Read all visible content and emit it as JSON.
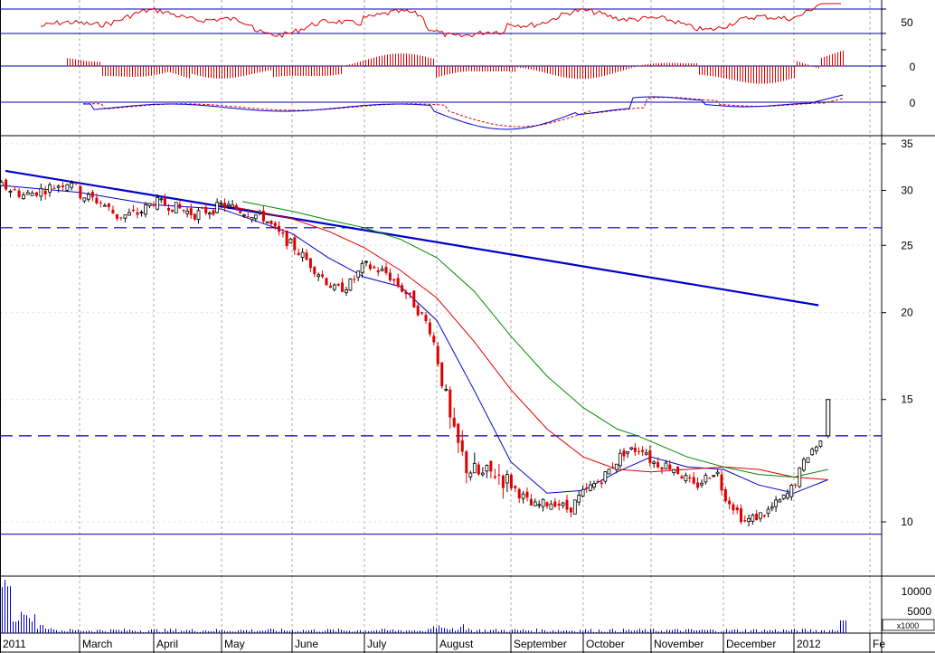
{
  "chart_data": {
    "type": "candlestick",
    "months": [
      "2011",
      "March",
      "April",
      "May",
      "June",
      "July",
      "August",
      "September",
      "October",
      "November",
      "December",
      "2012",
      "Fe"
    ],
    "price_axis": {
      "scale": "log",
      "ticks": [
        "35",
        "30",
        "25",
        "20",
        "15",
        "10"
      ],
      "ylim": [
        9,
        37
      ]
    },
    "volume_axis": {
      "ticks": [
        "10000",
        "5000"
      ],
      "unit": "x1000"
    },
    "indicator_ticks": {
      "rsi": [
        "50"
      ],
      "histogram": [
        "0"
      ],
      "macd": [
        "0"
      ]
    },
    "reference_levels": {
      "rsi_upper": 70,
      "rsi_lower": 30,
      "support_dashed_upper": 26.5,
      "support_dashed_lower": 13.3,
      "support_solid": 9.6
    },
    "trendline": {
      "start": {
        "x": 0.0,
        "y": 32.0
      },
      "end": {
        "x": 11.3,
        "y": 20.5
      }
    },
    "price_series": [
      {
        "x": 0.0,
        "y": 30.5
      },
      {
        "x": 0.3,
        "y": 29.5
      },
      {
        "x": 0.6,
        "y": 30.2
      },
      {
        "x": 0.9,
        "y": 31.0
      },
      {
        "x": 1.0,
        "y": 29.6
      },
      {
        "x": 1.3,
        "y": 28.8
      },
      {
        "x": 1.5,
        "y": 27.5
      },
      {
        "x": 1.8,
        "y": 27.8
      },
      {
        "x": 2.0,
        "y": 28.9
      },
      {
        "x": 2.3,
        "y": 28.4
      },
      {
        "x": 2.6,
        "y": 27.7
      },
      {
        "x": 2.9,
        "y": 28.2
      },
      {
        "x": 3.0,
        "y": 28.6
      },
      {
        "x": 3.3,
        "y": 28.0
      },
      {
        "x": 3.6,
        "y": 27.4
      },
      {
        "x": 3.8,
        "y": 26.0
      },
      {
        "x": 4.0,
        "y": 25.0
      },
      {
        "x": 4.3,
        "y": 23.2
      },
      {
        "x": 4.6,
        "y": 21.5
      },
      {
        "x": 4.8,
        "y": 22.0
      },
      {
        "x": 5.0,
        "y": 23.4
      },
      {
        "x": 5.3,
        "y": 22.8
      },
      {
        "x": 5.6,
        "y": 21.2
      },
      {
        "x": 5.9,
        "y": 19.0
      },
      {
        "x": 6.0,
        "y": 17.5
      },
      {
        "x": 6.2,
        "y": 13.5
      },
      {
        "x": 6.4,
        "y": 12.0
      },
      {
        "x": 6.6,
        "y": 11.6
      },
      {
        "x": 6.8,
        "y": 11.8
      },
      {
        "x": 7.0,
        "y": 11.3
      },
      {
        "x": 7.3,
        "y": 10.5
      },
      {
        "x": 7.6,
        "y": 10.7
      },
      {
        "x": 7.8,
        "y": 10.4
      },
      {
        "x": 8.0,
        "y": 11.0
      },
      {
        "x": 8.3,
        "y": 11.6
      },
      {
        "x": 8.6,
        "y": 12.6
      },
      {
        "x": 8.9,
        "y": 12.8
      },
      {
        "x": 9.0,
        "y": 12.2
      },
      {
        "x": 9.3,
        "y": 12.0
      },
      {
        "x": 9.6,
        "y": 11.2
      },
      {
        "x": 9.9,
        "y": 11.9
      },
      {
        "x": 10.0,
        "y": 11.0
      },
      {
        "x": 10.3,
        "y": 10.0
      },
      {
        "x": 10.6,
        "y": 10.3
      },
      {
        "x": 10.9,
        "y": 10.9
      },
      {
        "x": 11.0,
        "y": 11.3
      },
      {
        "x": 11.2,
        "y": 12.6
      },
      {
        "x": 11.35,
        "y": 13.0
      },
      {
        "x": 11.45,
        "y": 15.0
      }
    ],
    "ma_series": [
      {
        "color": "#0000cc",
        "points": [
          {
            "x": 0.0,
            "y": 30.5
          },
          {
            "x": 1.0,
            "y": 29.8
          },
          {
            "x": 2.0,
            "y": 28.6
          },
          {
            "x": 3.0,
            "y": 28.2
          },
          {
            "x": 4.0,
            "y": 26.0
          },
          {
            "x": 4.5,
            "y": 24.0
          },
          {
            "x": 5.0,
            "y": 22.5
          },
          {
            "x": 5.5,
            "y": 21.8
          },
          {
            "x": 6.0,
            "y": 19.5
          },
          {
            "x": 6.5,
            "y": 15.5
          },
          {
            "x": 7.0,
            "y": 12.2
          },
          {
            "x": 7.5,
            "y": 11.0
          },
          {
            "x": 8.0,
            "y": 11.1
          },
          {
            "x": 8.5,
            "y": 11.8
          },
          {
            "x": 9.0,
            "y": 12.4
          },
          {
            "x": 9.5,
            "y": 12.0
          },
          {
            "x": 10.0,
            "y": 11.9
          },
          {
            "x": 10.5,
            "y": 11.3
          },
          {
            "x": 11.0,
            "y": 11.0
          },
          {
            "x": 11.45,
            "y": 11.5
          }
        ]
      },
      {
        "color": "#dd0000",
        "points": [
          {
            "x": 3.0,
            "y": 28.6
          },
          {
            "x": 3.5,
            "y": 28.0
          },
          {
            "x": 4.0,
            "y": 27.3
          },
          {
            "x": 4.5,
            "y": 26.2
          },
          {
            "x": 5.0,
            "y": 24.8
          },
          {
            "x": 5.5,
            "y": 23.0
          },
          {
            "x": 6.0,
            "y": 21.0
          },
          {
            "x": 6.5,
            "y": 18.2
          },
          {
            "x": 7.0,
            "y": 15.5
          },
          {
            "x": 7.5,
            "y": 13.6
          },
          {
            "x": 8.0,
            "y": 12.4
          },
          {
            "x": 8.5,
            "y": 11.9
          },
          {
            "x": 9.0,
            "y": 11.8
          },
          {
            "x": 9.5,
            "y": 11.9
          },
          {
            "x": 10.0,
            "y": 12.0
          },
          {
            "x": 10.5,
            "y": 11.9
          },
          {
            "x": 11.0,
            "y": 11.6
          },
          {
            "x": 11.45,
            "y": 11.5
          }
        ]
      },
      {
        "color": "#008800",
        "points": [
          {
            "x": 3.3,
            "y": 28.9
          },
          {
            "x": 4.0,
            "y": 28.0
          },
          {
            "x": 4.5,
            "y": 27.2
          },
          {
            "x": 5.0,
            "y": 26.5
          },
          {
            "x": 5.5,
            "y": 25.5
          },
          {
            "x": 6.0,
            "y": 24.0
          },
          {
            "x": 6.5,
            "y": 21.5
          },
          {
            "x": 7.0,
            "y": 18.5
          },
          {
            "x": 7.5,
            "y": 16.2
          },
          {
            "x": 8.0,
            "y": 14.6
          },
          {
            "x": 8.5,
            "y": 13.6
          },
          {
            "x": 8.8,
            "y": 13.3
          },
          {
            "x": 9.5,
            "y": 12.4
          },
          {
            "x": 10.0,
            "y": 12.0
          },
          {
            "x": 10.5,
            "y": 11.7
          },
          {
            "x": 11.0,
            "y": 11.6
          },
          {
            "x": 11.45,
            "y": 11.9
          }
        ]
      }
    ],
    "colors": {
      "up": "#000000",
      "down": "#dd0000",
      "reference_line": "#0000aa",
      "trendline": "#0000cc",
      "grid": "#aaaaaa",
      "rsi_line": "#dd0000",
      "histogram": "#dd0000",
      "macd_line": "#0000cc",
      "macd_signal": "#dd0000",
      "volume": "#0000cc"
    },
    "grid": true
  }
}
